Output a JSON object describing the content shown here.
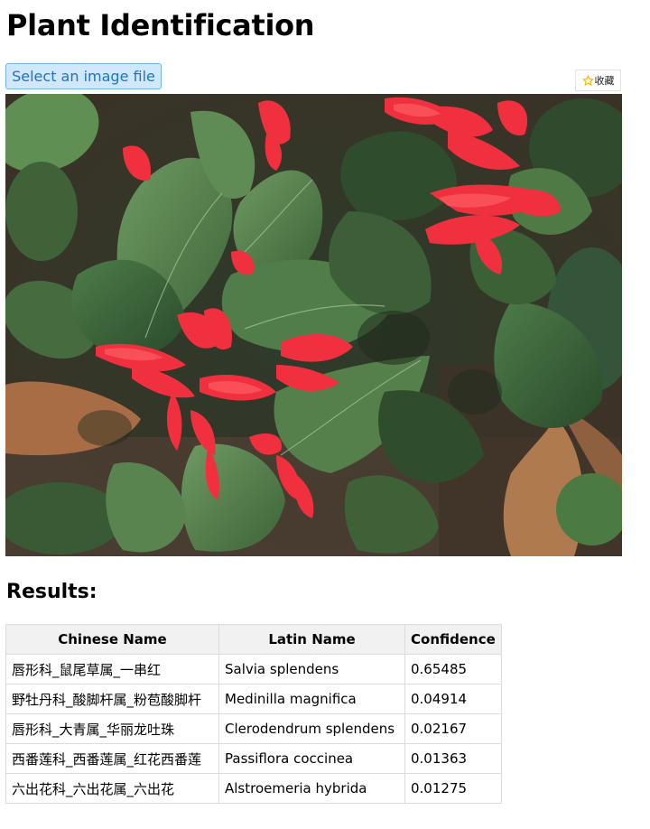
{
  "page": {
    "title": "Plant Identification"
  },
  "upload": {
    "button_label": "Select an image file"
  },
  "favorite": {
    "label": "收藏",
    "icon": "star-icon",
    "icon_color": "#f5b400"
  },
  "photo": {
    "alt": "Photo of plant with red flowers and green leaves",
    "colors": {
      "flower": "#f0303f",
      "leaf": "#4e7848",
      "soil": "#5a4636",
      "dry_leaf": "#a86d45"
    }
  },
  "results": {
    "heading": "Results:",
    "columns": [
      "Chinese Name",
      "Latin Name",
      "Confidence"
    ],
    "rows": [
      {
        "chinese": "唇形科_鼠尾草属_一串红",
        "latin": "Salvia splendens",
        "confidence": "0.65485"
      },
      {
        "chinese": "野牡丹科_酸脚杆属_粉苞酸脚杆",
        "latin": "Medinilla magnifica",
        "confidence": "0.04914"
      },
      {
        "chinese": "唇形科_大青属_华丽龙吐珠",
        "latin": "Clerodendrum splendens",
        "confidence": "0.02167"
      },
      {
        "chinese": "西番莲科_西番莲属_红花西番莲",
        "latin": "Passiflora coccinea",
        "confidence": "0.01363"
      },
      {
        "chinese": "六出花科_六出花属_六出花",
        "latin": "Alstroemeria hybrida",
        "confidence": "0.01275"
      }
    ]
  }
}
